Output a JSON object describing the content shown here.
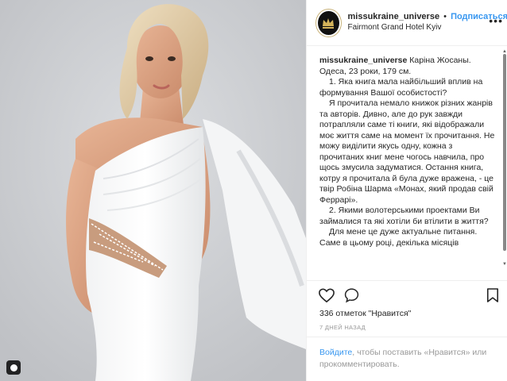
{
  "header": {
    "username": "missukraine_universe",
    "separator": "•",
    "follow_label": "Подписаться",
    "location": "Fairmont Grand Hotel Kyiv"
  },
  "caption": {
    "username": "missukraine_universe",
    "lines": [
      "Каріна Жосаны.",
      "Одеса, 23 роки, 179 см.",
      "1. Яка книга мала найбільший вплив на формування Вашої особистості?",
      "Я прочитала немало книжок різних жанрів та авторів. Дивно, але до рук завжди потрапляли саме ті книги, які відображали моє життя саме на момент їх прочитання. Не можу виділити якусь одну, кожна з прочитаних книг мене чогось навчила, про щось змусила задуматися. Остання книга, котру я прочитала й була дуже вражена, - це твір Робіна Шарма «Монах, який продав свій Феррарі».",
      "2. Якими волотерськими проектами Ви займалися та які хотіли би втілити в життя?",
      "Для мене це дуже актуальне питання. Саме в цьому році, декілька місяців"
    ]
  },
  "stats": {
    "likes": "336 отметок \"Нравится\"",
    "time": "7 ДНЕЙ НАЗАД"
  },
  "login_prompt": {
    "link": "Войдите",
    "text": ", чтобы поставить «Нравится» или прокомментировать."
  },
  "icons": {
    "like": "heart-icon",
    "comment": "comment-bubble-icon",
    "save": "bookmark-icon",
    "more": "ellipsis-icon",
    "photo_badge": "tagged-user-icon"
  },
  "colors": {
    "accent": "#3897f0",
    "text": "#262626",
    "muted": "#999999",
    "border": "#efefef"
  }
}
